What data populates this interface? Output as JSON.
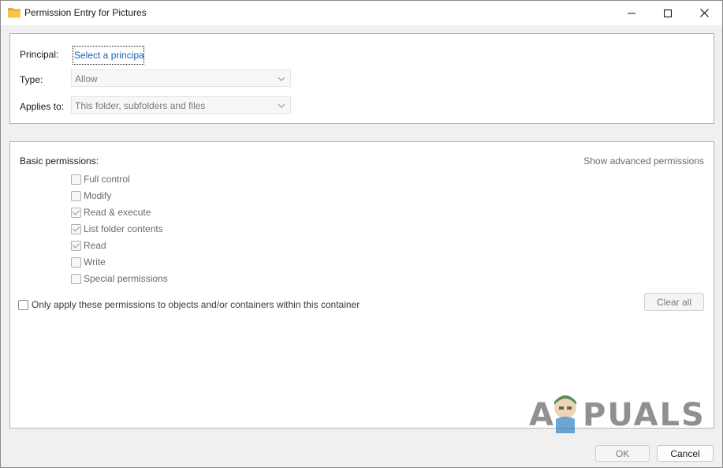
{
  "window": {
    "title": "Permission Entry for Pictures",
    "icon": "folder-icon",
    "controls": [
      "minimize-icon",
      "maximize-icon",
      "close-icon"
    ]
  },
  "principal": {
    "label": "Principal:",
    "link_text": "Select a principal"
  },
  "type": {
    "label": "Type:",
    "value": "Allow"
  },
  "applies_to": {
    "label": "Applies to:",
    "value": "This folder, subfolders and files"
  },
  "permissions": {
    "heading": "Basic permissions:",
    "advanced_link": "Show advanced permissions",
    "items": [
      {
        "label": "Full control",
        "checked": false
      },
      {
        "label": "Modify",
        "checked": false
      },
      {
        "label": "Read & execute",
        "checked": true
      },
      {
        "label": "List folder contents",
        "checked": true
      },
      {
        "label": "Read",
        "checked": true
      },
      {
        "label": "Write",
        "checked": false
      },
      {
        "label": "Special permissions",
        "checked": false
      }
    ]
  },
  "only_apply": {
    "label": "Only apply these permissions to objects and/or containers within this container",
    "checked": false
  },
  "buttons": {
    "clear_all": "Clear all",
    "ok": "OK",
    "cancel": "Cancel"
  },
  "watermark": {
    "text": "APPUALS"
  },
  "colors": {
    "link": "#1a5fb4",
    "disabled_text": "#6a6a6a",
    "window_bg": "#f0f0f0",
    "panel_bg": "#ffffff"
  }
}
